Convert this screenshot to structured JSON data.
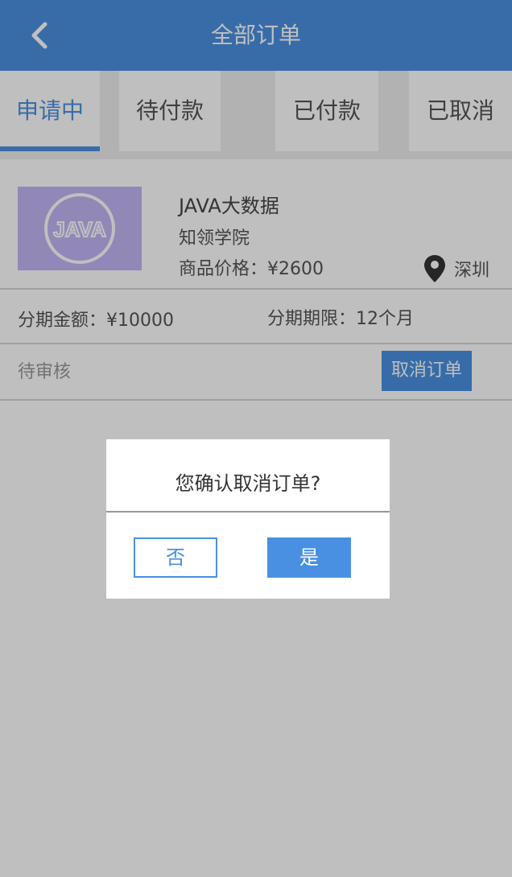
{
  "header": {
    "title": "全部订单",
    "back_icon": "chevron-left-icon"
  },
  "tabs": [
    {
      "label": "申请中",
      "active": true
    },
    {
      "label": "待付款",
      "active": false
    },
    {
      "label": "已付款",
      "active": false
    },
    {
      "label": "已取消",
      "active": false
    }
  ],
  "order": {
    "course_name": "JAVA大数据",
    "school": "知领学院",
    "price": "商品价格：¥2600",
    "location": "深圳",
    "installment_amount": "分期金额：¥10000",
    "installment_term": "分期期限：12个月",
    "status": "待审核",
    "cancel_label": "取消订单",
    "thumbnail_text": "JAVA"
  },
  "dialog": {
    "title": "您确认取消订单?",
    "no_label": "否",
    "yes_label": "是"
  },
  "colors": {
    "accent": "#4a90e2",
    "thumb_bg": "#c2b6f5"
  }
}
